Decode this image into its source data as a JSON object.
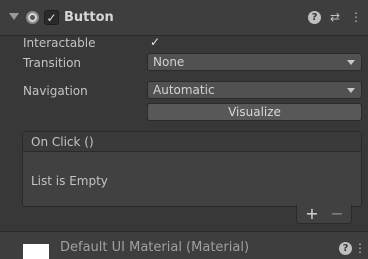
{
  "component": {
    "title": "Button",
    "enabled_check": "✓",
    "help_glyph": "?",
    "presets_glyph": "⇄",
    "menu_glyph": "⋮"
  },
  "fields": {
    "interactable_label": "Interactable",
    "interactable_value": "✓",
    "transition_label": "Transition",
    "transition_value": "None",
    "navigation_label": "Navigation",
    "navigation_value": "Automatic",
    "visualize_label": "Visualize"
  },
  "on_click": {
    "header": "On Click ()",
    "empty_text": "List is Empty",
    "add_glyph": "+",
    "remove_glyph": "−"
  },
  "material": {
    "title": "Default UI Material (Material)",
    "help_glyph": "?",
    "menu_glyph": "⋮"
  },
  "colors": {
    "panel_bg": "#383838",
    "header_bg": "#3e3e3e",
    "field_bg": "#515151"
  }
}
